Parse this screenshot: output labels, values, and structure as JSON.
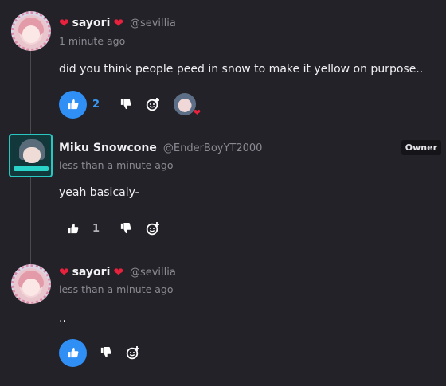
{
  "comments": [
    {
      "author": "sayori",
      "author_prefix_icon": "heart-icon",
      "author_suffix_icon": "heart-icon",
      "handle": "@sevillia",
      "time": "1 minute ago",
      "text": "did you think people peed in snow to make it yellow on purpose..",
      "likes": "2",
      "liked": true,
      "has_reaction": true
    },
    {
      "author": "Miku Snowcone",
      "handle": "@EnderBoyYT2000",
      "time": "less than a minute ago",
      "text": "yeah basicaly-",
      "badge": "Owner",
      "likes": "1",
      "liked": false
    },
    {
      "author": "sayori",
      "author_prefix_icon": "heart-icon",
      "author_suffix_icon": "heart-icon",
      "handle": "@sevillia",
      "time": "less than a minute ago",
      "text": "..",
      "likes": "",
      "liked": true
    }
  ],
  "colors": {
    "background": "#232228",
    "like_active": "#2f8ff5",
    "heart": "#e8213d",
    "owner_avatar_border": "#28c7c2"
  }
}
